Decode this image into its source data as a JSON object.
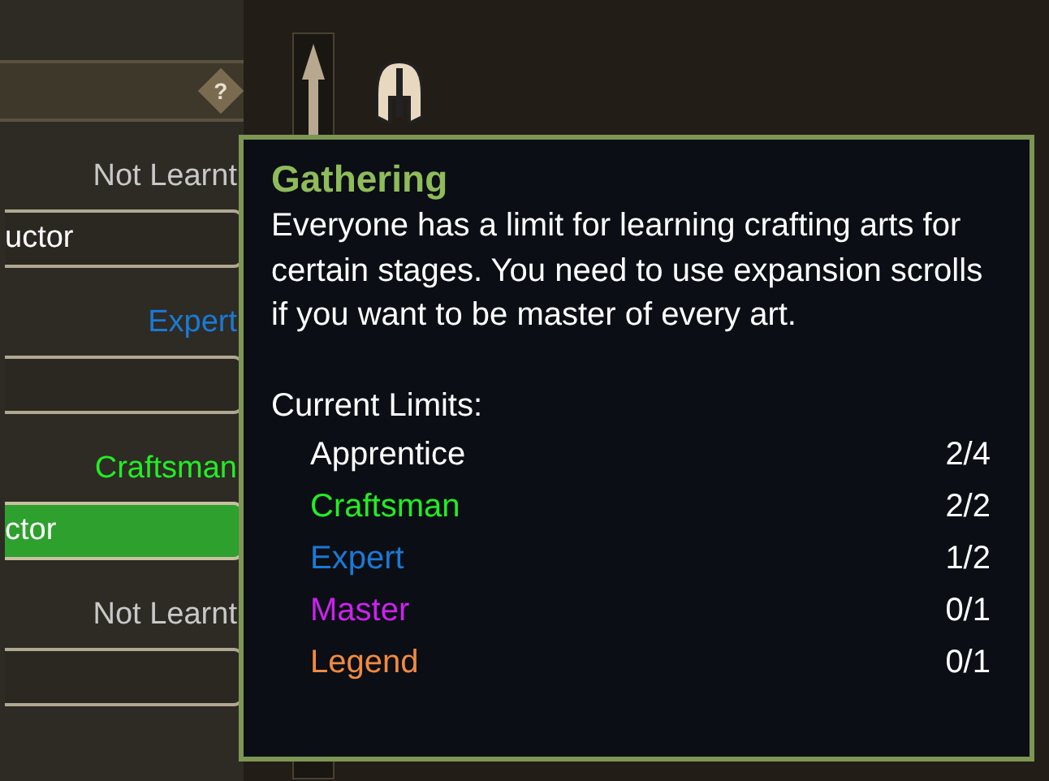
{
  "panel": {
    "help_label": "?",
    "rows": [
      {
        "level": "Not Learnt",
        "color": "#c8c8c8",
        "bar": {
          "label": "uctor",
          "selected": false
        }
      },
      {
        "level": "Expert",
        "color": "#1a7ad6",
        "bar": {
          "selected": false
        }
      },
      {
        "level": "Craftsman",
        "color": "#22ee22",
        "bar": {
          "label": "ctor",
          "selected": true
        }
      },
      {
        "level": "Not Learnt",
        "color": "#c8c8c8",
        "bar": {
          "selected": false
        }
      }
    ]
  },
  "tooltip": {
    "title": "Gathering",
    "description": "Everyone has a limit for learning crafting arts for certain stages. You need to use expansion scrolls if you want to be master of every art.",
    "limits_heading": "Current Limits:",
    "limits": [
      {
        "name": "Apprentice",
        "count": "2/4",
        "color": "#ffffff"
      },
      {
        "name": "Craftsman",
        "count": "2/2",
        "color": "#22ee22"
      },
      {
        "name": "Expert",
        "count": "1/2",
        "color": "#1a7ad6"
      },
      {
        "name": "Master",
        "count": "0/1",
        "color": "#cc22ee"
      },
      {
        "name": "Legend",
        "count": "0/1",
        "color": "#f08a40"
      }
    ]
  }
}
